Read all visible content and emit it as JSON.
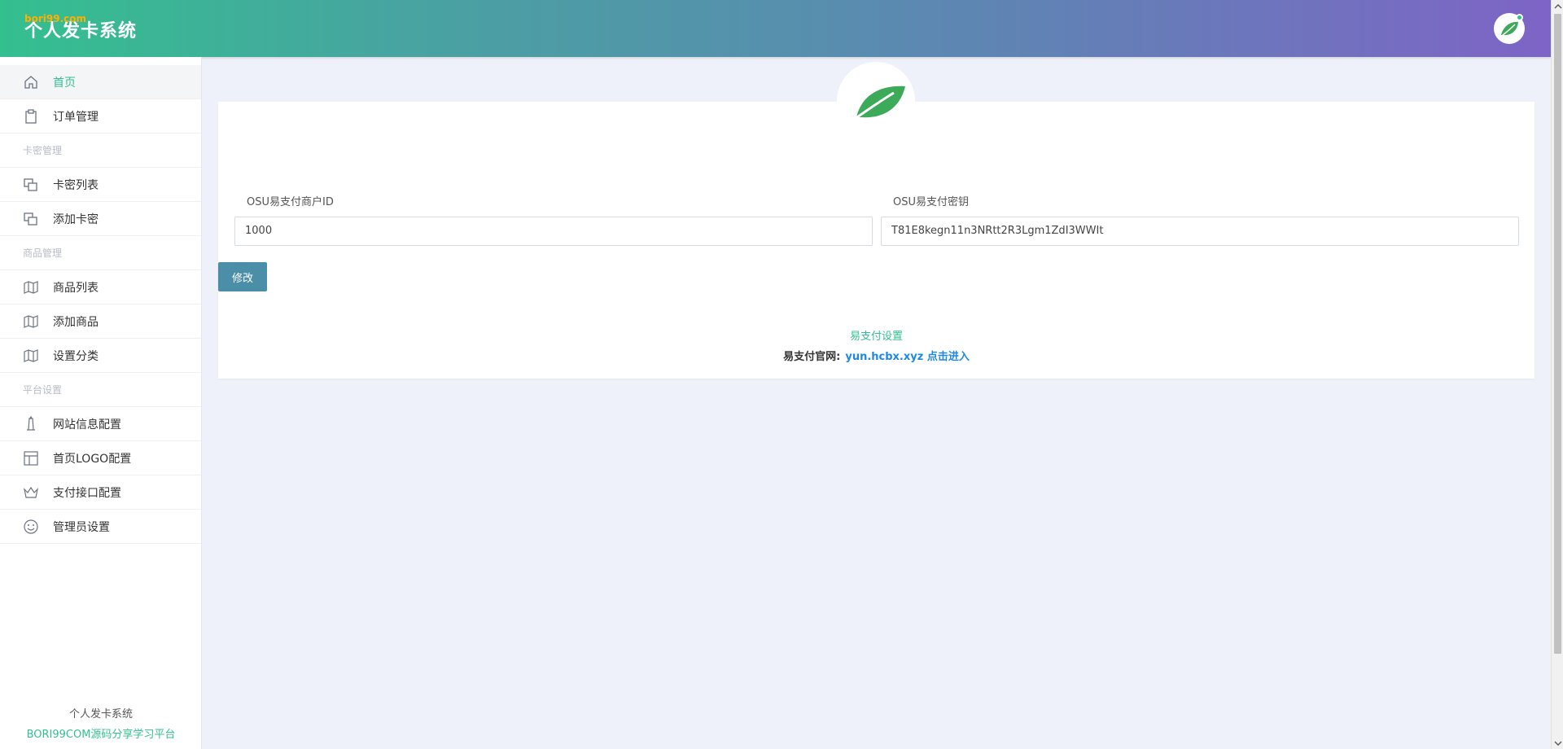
{
  "header": {
    "brand": "个人发卡系统",
    "watermark": "bori99.com"
  },
  "sidebar": {
    "items": [
      {
        "label": "首页",
        "icon": "home-icon",
        "active": true
      },
      {
        "label": "订单管理",
        "icon": "clipboard-icon"
      }
    ],
    "groups": [
      {
        "title": "卡密管理",
        "items": [
          {
            "label": "卡密列表",
            "icon": "copy-icon"
          },
          {
            "label": "添加卡密",
            "icon": "copy-icon"
          }
        ]
      },
      {
        "title": "商品管理",
        "items": [
          {
            "label": "商品列表",
            "icon": "map-icon"
          },
          {
            "label": "添加商品",
            "icon": "map-icon"
          },
          {
            "label": "设置分类",
            "icon": "map-icon"
          }
        ]
      },
      {
        "title": "平台设置",
        "items": [
          {
            "label": "网站信息配置",
            "icon": "lighthouse-icon"
          },
          {
            "label": "首页LOGO配置",
            "icon": "layout-icon"
          },
          {
            "label": "支付接口配置",
            "icon": "crown-icon"
          },
          {
            "label": "管理员设置",
            "icon": "smile-icon"
          }
        ]
      }
    ],
    "footer": {
      "title": "个人发卡系统",
      "subtitle": "BORI99COM源码分享学习平台"
    }
  },
  "form": {
    "merchant_id_label": "OSU易支付商户ID",
    "merchant_id_value": "1000",
    "secret_label": "OSU易支付密钥",
    "secret_value": "T81E8kegn11n3NRtt2R3Lgm1ZdI3WWIt",
    "submit_label": "修改"
  },
  "info": {
    "title": "易支付设置",
    "site_label": "易支付官网:",
    "site_link": "yun.hcbx.xyz 点击进入"
  },
  "colors": {
    "accent": "#34bf8f",
    "button": "#4b8ea7",
    "link": "#1e88e5"
  }
}
